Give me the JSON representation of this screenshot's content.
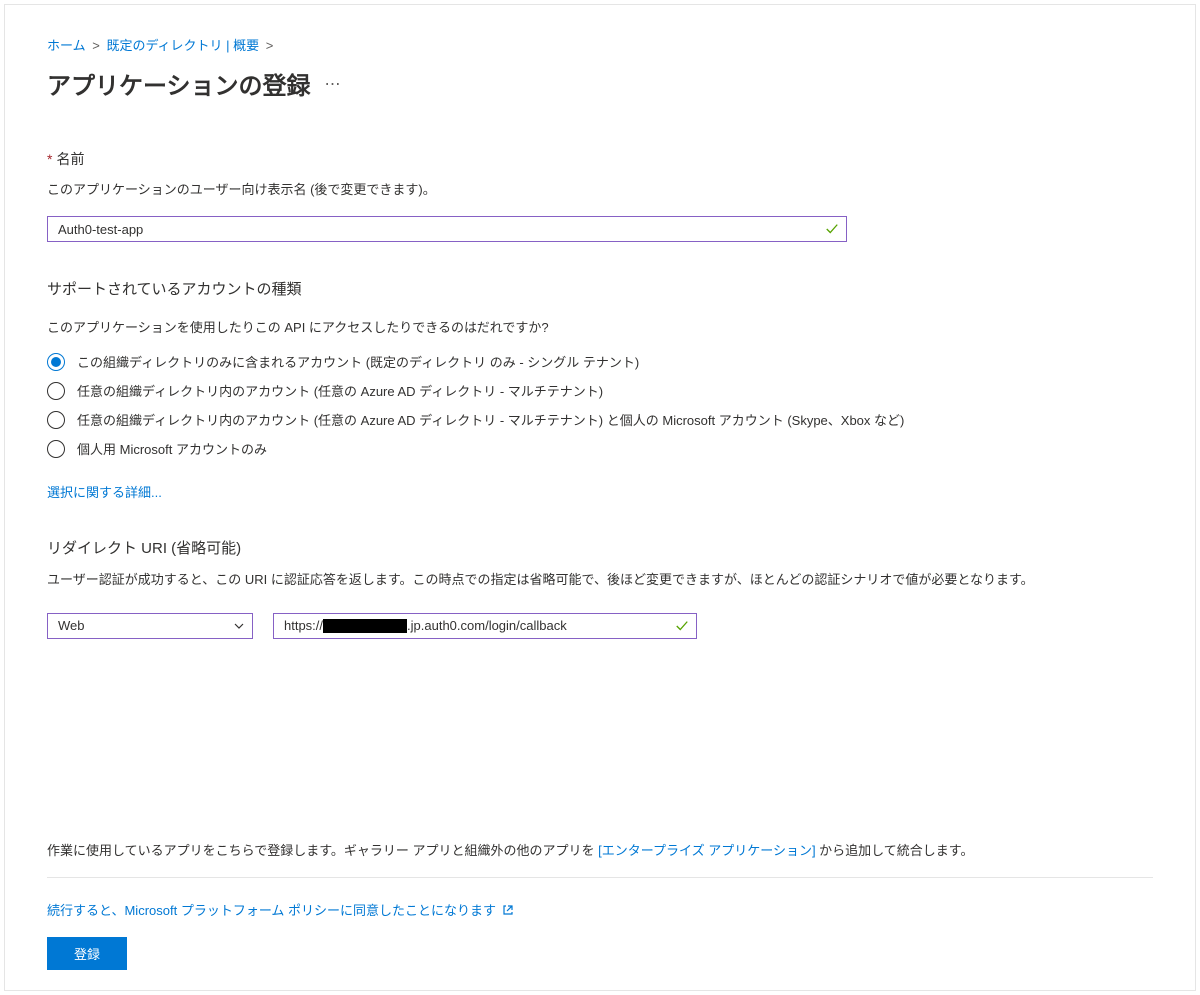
{
  "breadcrumb": {
    "items": [
      "ホーム",
      "既定のディレクトリ | 概要"
    ]
  },
  "page_title": "アプリケーションの登録",
  "name_section": {
    "label": "名前",
    "helper": "このアプリケーションのユーザー向け表示名 (後で変更できます)。",
    "value": "Auth0-test-app"
  },
  "account_type_section": {
    "heading": "サポートされているアカウントの種類",
    "question": "このアプリケーションを使用したりこの API にアクセスしたりできるのはだれですか?",
    "options": [
      "この組織ディレクトリのみに含まれるアカウント (既定のディレクトリ のみ - シングル テナント)",
      "任意の組織ディレクトリ内のアカウント (任意の Azure AD ディレクトリ - マルチテナント)",
      "任意の組織ディレクトリ内のアカウント (任意の Azure AD ディレクトリ - マルチテナント) と個人の Microsoft アカウント (Skype、Xbox など)",
      "個人用 Microsoft アカウントのみ"
    ],
    "selected_index": 0,
    "help_link": "選択に関する詳細..."
  },
  "redirect_section": {
    "heading": "リダイレクト URI (省略可能)",
    "desc": "ユーザー認証が成功すると、この URI に認証応答を返します。この時点での指定は省略可能で、後ほど変更できますが、ほとんどの認証シナリオで値が必要となります。",
    "platform": "Web",
    "uri_prefix": "https://",
    "uri_suffix": ".jp.auth0.com/login/callback"
  },
  "footer": {
    "note_before": "作業に使用しているアプリをこちらで登録します。ギャラリー アプリと組織外の他のアプリを ",
    "note_link": "[エンタープライズ アプリケーション]",
    "note_after": " から追加して統合します。",
    "policy_text": "続行すると、Microsoft プラットフォーム ポリシーに同意したことになります",
    "register_button": "登録"
  }
}
